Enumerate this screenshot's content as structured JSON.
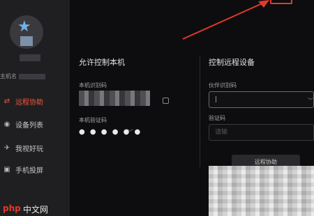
{
  "sidebar": {
    "hostname_label": "主机名",
    "items": [
      {
        "label": "远程协助",
        "icon": "remote-assist-icon",
        "active": true
      },
      {
        "label": "设备列表",
        "icon": "device-list-icon",
        "active": false
      },
      {
        "label": "我视好玩",
        "icon": "satellite-icon",
        "active": false
      },
      {
        "label": "手机投屏",
        "icon": "phone-cast-icon",
        "active": false
      }
    ]
  },
  "left_panel": {
    "title": "允许控制本机",
    "id_label": "本机识别码",
    "code_label": "本机验证码",
    "code_value": "● ● ● ● ● ●"
  },
  "right_panel": {
    "title": "控制远程设备",
    "partner_id_label": "伙伴识别码",
    "partner_id_value": "|",
    "code_label": "验证码",
    "code_placeholder": "请输",
    "connect_button": "远程协助"
  },
  "watermark": {
    "logo": "php",
    "text": "中文网"
  },
  "colors": {
    "accent": "#f05a3c",
    "annotation": "#e23a2a",
    "background": "#0d0d0f",
    "sidebar": "#1f1f22"
  }
}
